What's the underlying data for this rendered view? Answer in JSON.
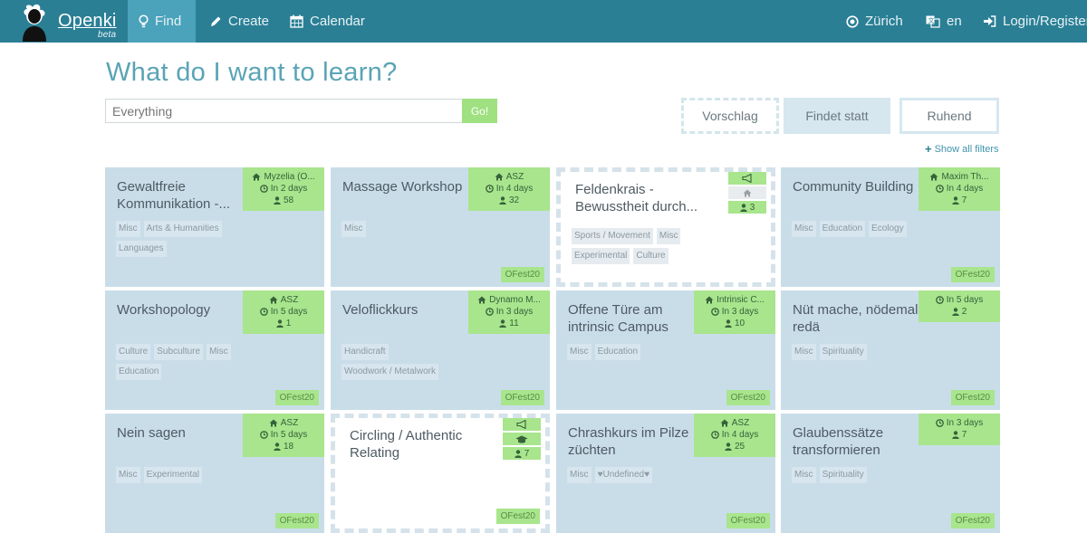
{
  "nav": {
    "brand": "Openki",
    "beta": "beta",
    "find": "Find",
    "create": "Create",
    "calendar": "Calendar",
    "region": "Zürich",
    "language": "en",
    "login": "Login/Register"
  },
  "header": {
    "title": "What do I want to learn?",
    "search_placeholder": "Everything",
    "go": "Go!",
    "filter_proposal": "Vorschlag",
    "filter_ongoing": "Findet statt",
    "filter_resting": "Ruhend",
    "show_filters": "Show all filters"
  },
  "colors": {
    "nav": "#2a7f95",
    "active": "#4aa3bb",
    "green": "#a8e58d",
    "card": "#c9dde9"
  },
  "cards": [
    {
      "title": "Gewaltfreie Kommunikation -...",
      "tags": [
        "Misc",
        "Arts & Humanities",
        "Languages"
      ],
      "venue": "Myzelia (O...",
      "when": "In 2 days",
      "people": "58",
      "badge": ""
    },
    {
      "title": "Massage Workshop",
      "tags": [
        "Misc"
      ],
      "venue": "ASZ",
      "when": "In 4 days",
      "people": "32",
      "badge": "OFest20"
    },
    {
      "title": "Feldenkrais - Bewusstheit durch...",
      "tags": [
        "Sports / Movement",
        "Misc",
        "Experimental",
        "Culture"
      ],
      "people": "3",
      "badge": ""
    },
    {
      "title": "Community Building",
      "tags": [
        "Misc",
        "Education",
        "Ecology"
      ],
      "venue": "Maxim Th...",
      "when": "In 4 days",
      "people": "7",
      "badge": "OFest20"
    },
    {
      "title": "Workshopology",
      "tags": [
        "Culture",
        "Subculture",
        "Misc",
        "Education"
      ],
      "venue": "ASZ",
      "when": "In 5 days",
      "people": "1",
      "badge": "OFest20"
    },
    {
      "title": "Veloflickkurs",
      "tags": [
        "Handicraft",
        "Woodwork / Metalwork"
      ],
      "venue": "Dynamo M...",
      "when": "In 3 days",
      "people": "11",
      "badge": "OFest20"
    },
    {
      "title": "Offene Türe am intrinsic Campus",
      "tags": [
        "Misc",
        "Education"
      ],
      "venue": "Intrinsic C...",
      "when": "In 3 days",
      "people": "10",
      "badge": "OFest20"
    },
    {
      "title": "Nüt mache, nödemal redä",
      "tags": [
        "Misc",
        "Spirituality"
      ],
      "when": "In 5 days",
      "people": "2",
      "badge": "OFest20"
    },
    {
      "title": "Nein sagen",
      "tags": [
        "Misc",
        "Experimental"
      ],
      "venue": "ASZ",
      "when": "In 5 days",
      "people": "18",
      "badge": "OFest20"
    },
    {
      "title": "Circling / Authentic Relating",
      "tags": [],
      "people": "7",
      "badge": "OFest20"
    },
    {
      "title": "Chrashkurs im Pilze züchten",
      "tags": [
        "Misc",
        "♥Undefined♥"
      ],
      "venue": "ASZ",
      "when": "In 4 days",
      "people": "25",
      "badge": "OFest20"
    },
    {
      "title": "Glaubenssätze transformieren",
      "tags": [
        "Misc",
        "Spirituality"
      ],
      "when": "In 3 days",
      "people": "7",
      "badge": "OFest20"
    }
  ]
}
